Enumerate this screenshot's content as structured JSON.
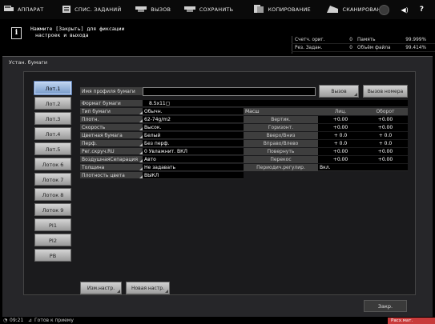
{
  "tabs": [
    {
      "label": "АППАРАТ",
      "icon": "machine-icon"
    },
    {
      "label": "СПИС. ЗАДАНИЙ",
      "icon": "job-list-icon"
    },
    {
      "label": "ВЫЗОВ",
      "icon": "recall-icon"
    },
    {
      "label": "СОХРАНИТЬ",
      "icon": "save-icon"
    },
    {
      "label": "КОПИРОВАНИЕ",
      "icon": "copy-icon"
    },
    {
      "label": "СКАНИРОВАНИЕ",
      "icon": "scan-icon"
    }
  ],
  "message": {
    "line1": "Нажмите [Закрыть] для фиксации",
    "line2": "настроек и выхода"
  },
  "counters": {
    "orig_label": "Счетч. ориг.",
    "orig_value": "0",
    "reserved_label": "Рез. Задан.",
    "reserved_value": "0",
    "memory_label": "Память",
    "memory_value": "99.999%",
    "file_label": "Объём файла",
    "file_value": "99.414%"
  },
  "panel_title": "Устан. бумаги",
  "trays": [
    {
      "label": "Лот.1",
      "selected": true
    },
    {
      "label": "Лот.2"
    },
    {
      "label": "Лот.3"
    },
    {
      "label": "Лот.4"
    },
    {
      "label": "Лот.5"
    },
    {
      "label": "Лоток 6"
    },
    {
      "label": "Лоток 7"
    },
    {
      "label": "Лоток 8"
    },
    {
      "label": "Лоток 9"
    },
    {
      "label": "PI1"
    },
    {
      "label": "PI2"
    },
    {
      "label": "PB"
    }
  ],
  "profile": {
    "label": "Имя профиля бумаги",
    "value": "",
    "recall_button": "Вызов",
    "recall_number_button": "Вызов номера"
  },
  "paper_size": {
    "label": "Формат бумаги",
    "value": "8.5x11▢"
  },
  "settings": [
    {
      "label": "Тип бумаги",
      "value": "Обычн."
    },
    {
      "label": "Плотн.",
      "value": "62-74g/m2"
    },
    {
      "label": "Скорость",
      "value": "Высок."
    },
    {
      "label": "Цветная бумага",
      "value": "Белый"
    },
    {
      "label": "Перф.",
      "value": "Без перф."
    },
    {
      "label": "Рег.скруч.RU",
      "value": "0    Увлажнит.  ВКЛ"
    },
    {
      "label": "ВоздушнаяСепарация",
      "value": "Авто"
    },
    {
      "label": "Толщина",
      "value": "Не задавать"
    },
    {
      "label": "Плотность цвета",
      "value": "ВЫКЛ"
    }
  ],
  "mass": {
    "header": "Масш",
    "col_front": "Лиц.",
    "col_back": "Оборот",
    "rows": [
      {
        "label": "Вертик.",
        "front": "+0.00",
        "back": "+0.00"
      },
      {
        "label": "Горизонт.",
        "front": "+0.00",
        "back": "+0.00"
      },
      {
        "label": "Вверх/Вниз",
        "front": "+ 0.0",
        "back": "+ 0.0"
      },
      {
        "label": "Вправо/Влево",
        "front": "+ 0.0",
        "back": "+ 0.0"
      },
      {
        "label": "Повернуть",
        "front": "+0.00",
        "back": "+0.00"
      },
      {
        "label": "Перекос",
        "front": "+0.00",
        "back": "+0.00"
      }
    ],
    "periodic_label": "Периодич.регулир.",
    "periodic_value": "Вкл."
  },
  "buttons": {
    "change_settings": "Изм.настр.",
    "new_settings": "Новая настр.",
    "close": "Закр."
  },
  "status": {
    "time": "09:21",
    "text": "Готов к приему",
    "badge": "Расх.мат."
  }
}
